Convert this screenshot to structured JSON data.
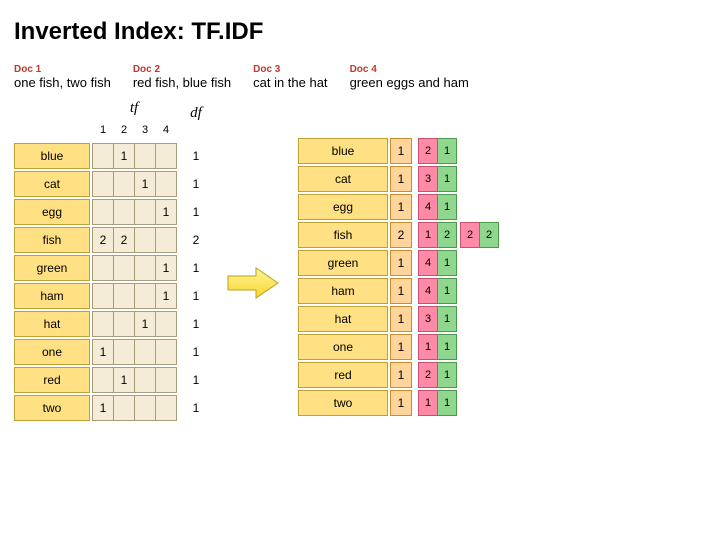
{
  "title": "Inverted Index: TF.IDF",
  "docs": [
    {
      "label": "Doc 1",
      "text": "one fish, two fish"
    },
    {
      "label": "Doc 2",
      "text": "red fish, blue fish"
    },
    {
      "label": "Doc 3",
      "text": "cat in the hat"
    },
    {
      "label": "Doc 4",
      "text": "green eggs and ham"
    }
  ],
  "left": {
    "tf_label": "tf",
    "df_label": "df",
    "col_headers": [
      "1",
      "2",
      "3",
      "4"
    ],
    "rows": [
      {
        "term": "blue",
        "tf": [
          "",
          "1",
          "",
          ""
        ],
        "df": "1"
      },
      {
        "term": "cat",
        "tf": [
          "",
          "",
          "1",
          ""
        ],
        "df": "1"
      },
      {
        "term": "egg",
        "tf": [
          "",
          "",
          "",
          "1"
        ],
        "df": "1"
      },
      {
        "term": "fish",
        "tf": [
          "2",
          "2",
          "",
          ""
        ],
        "df": "2"
      },
      {
        "term": "green",
        "tf": [
          "",
          "",
          "",
          "1"
        ],
        "df": "1"
      },
      {
        "term": "ham",
        "tf": [
          "",
          "",
          "",
          "1"
        ],
        "df": "1"
      },
      {
        "term": "hat",
        "tf": [
          "",
          "",
          "1",
          ""
        ],
        "df": "1"
      },
      {
        "term": "one",
        "tf": [
          "1",
          "",
          "",
          ""
        ],
        "df": "1"
      },
      {
        "term": "red",
        "tf": [
          "",
          "1",
          "",
          ""
        ],
        "df": "1"
      },
      {
        "term": "two",
        "tf": [
          "1",
          "",
          "",
          ""
        ],
        "df": "1"
      }
    ]
  },
  "right": {
    "rows": [
      {
        "term": "blue",
        "df": "1",
        "postings": [
          [
            "2",
            "1"
          ]
        ]
      },
      {
        "term": "cat",
        "df": "1",
        "postings": [
          [
            "3",
            "1"
          ]
        ]
      },
      {
        "term": "egg",
        "df": "1",
        "postings": [
          [
            "4",
            "1"
          ]
        ]
      },
      {
        "term": "fish",
        "df": "2",
        "postings": [
          [
            "1",
            "2"
          ],
          [
            "2",
            "2"
          ]
        ]
      },
      {
        "term": "green",
        "df": "1",
        "postings": [
          [
            "4",
            "1"
          ]
        ]
      },
      {
        "term": "ham",
        "df": "1",
        "postings": [
          [
            "4",
            "1"
          ]
        ]
      },
      {
        "term": "hat",
        "df": "1",
        "postings": [
          [
            "3",
            "1"
          ]
        ]
      },
      {
        "term": "one",
        "df": "1",
        "postings": [
          [
            "1",
            "1"
          ]
        ]
      },
      {
        "term": "red",
        "df": "1",
        "postings": [
          [
            "2",
            "1"
          ]
        ]
      },
      {
        "term": "two",
        "df": "1",
        "postings": [
          [
            "1",
            "1"
          ]
        ]
      }
    ]
  },
  "chart_data": {
    "type": "table",
    "title": "Inverted Index: TF.IDF",
    "documents": {
      "1": "one fish, two fish",
      "2": "red fish, blue fish",
      "3": "cat in the hat",
      "4": "green eggs and ham"
    },
    "tf_matrix": {
      "columns": [
        "1",
        "2",
        "3",
        "4"
      ],
      "rows": {
        "blue": [
          0,
          1,
          0,
          0
        ],
        "cat": [
          0,
          0,
          1,
          0
        ],
        "egg": [
          0,
          0,
          0,
          1
        ],
        "fish": [
          2,
          2,
          0,
          0
        ],
        "green": [
          0,
          0,
          0,
          1
        ],
        "ham": [
          0,
          0,
          0,
          1
        ],
        "hat": [
          0,
          0,
          1,
          0
        ],
        "one": [
          1,
          0,
          0,
          0
        ],
        "red": [
          0,
          1,
          0,
          0
        ],
        "two": [
          1,
          0,
          0,
          0
        ]
      }
    },
    "df": {
      "blue": 1,
      "cat": 1,
      "egg": 1,
      "fish": 2,
      "green": 1,
      "ham": 1,
      "hat": 1,
      "one": 1,
      "red": 1,
      "two": 1
    },
    "postings": {
      "blue": [
        [
          2,
          1
        ]
      ],
      "cat": [
        [
          3,
          1
        ]
      ],
      "egg": [
        [
          4,
          1
        ]
      ],
      "fish": [
        [
          1,
          2
        ],
        [
          2,
          2
        ]
      ],
      "green": [
        [
          4,
          1
        ]
      ],
      "ham": [
        [
          4,
          1
        ]
      ],
      "hat": [
        [
          3,
          1
        ]
      ],
      "one": [
        [
          1,
          1
        ]
      ],
      "red": [
        [
          2,
          1
        ]
      ],
      "two": [
        [
          1,
          1
        ]
      ]
    }
  }
}
